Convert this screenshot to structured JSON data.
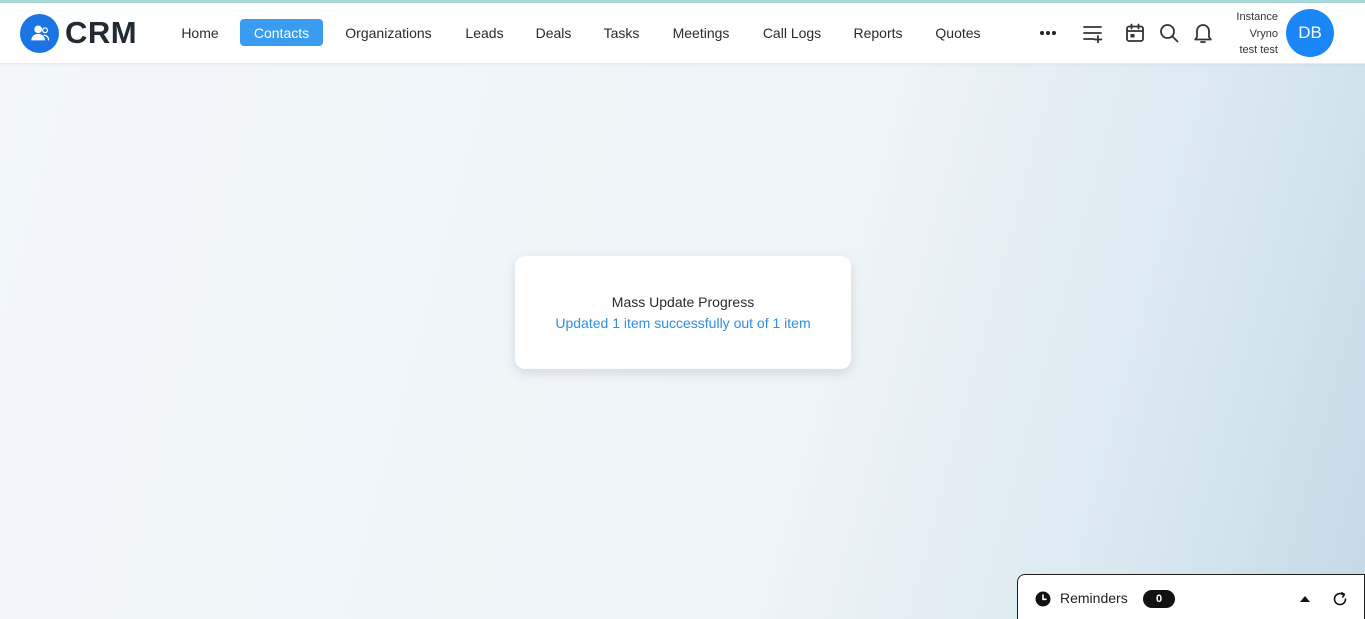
{
  "app": {
    "logo_text": "CRM"
  },
  "nav": {
    "items": [
      {
        "label": "Home"
      },
      {
        "label": "Contacts"
      },
      {
        "label": "Organizations"
      },
      {
        "label": "Leads"
      },
      {
        "label": "Deals"
      },
      {
        "label": "Tasks"
      },
      {
        "label": "Meetings"
      },
      {
        "label": "Call Logs"
      },
      {
        "label": "Reports"
      },
      {
        "label": "Quotes"
      }
    ],
    "active": "Contacts"
  },
  "header_icons": [
    "more-dots-icon",
    "add-list-icon",
    "calendar-icon",
    "search-icon",
    "bell-icon"
  ],
  "user": {
    "line1": "Instance",
    "line2": "Vryno",
    "line3": "test test",
    "initials": "DB"
  },
  "modal": {
    "title": "Mass Update Progress",
    "message": "Updated 1 item successfully out of 1 item"
  },
  "reminders": {
    "label": "Reminders",
    "count": "0"
  },
  "colors": {
    "accent": "#3a9cf1",
    "brand": "#1b74e4",
    "avatar": "#1a86f7",
    "success_text": "#2e8fe6"
  }
}
